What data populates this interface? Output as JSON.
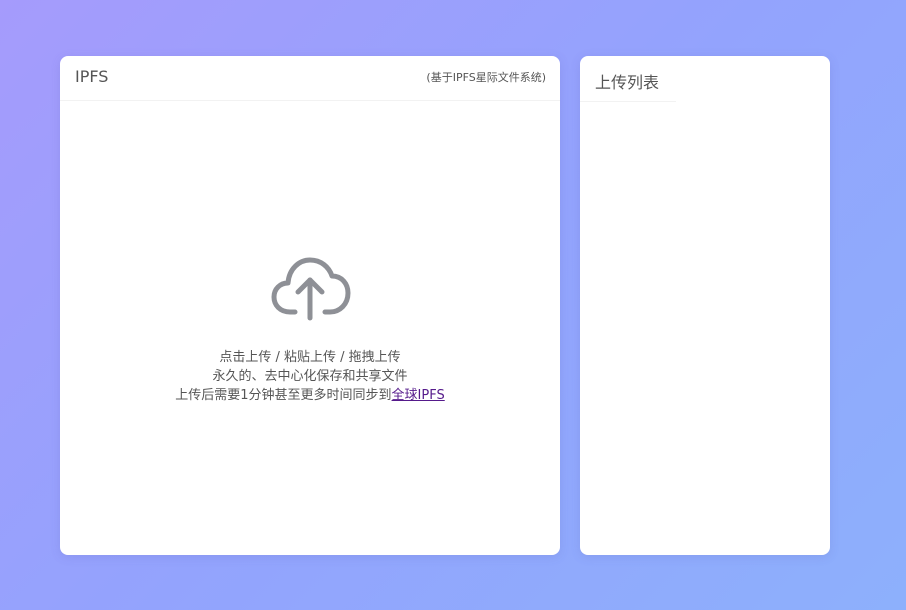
{
  "upload_panel": {
    "title": "IPFS",
    "subtitle": "(基于IPFS星际文件系统)",
    "hint_line1": "点击上传 / 粘贴上传 / 拖拽上传",
    "hint_line2": "永久的、去中心化保存和共享文件",
    "hint_line3_prefix": "上传后需要1分钟甚至更多时间同步到",
    "hint_line3_link": "全球IPFS",
    "icon": "cloud-upload-icon"
  },
  "list_panel": {
    "title": "上传列表",
    "items": []
  },
  "colors": {
    "background_gradient_start": "#a59bfc",
    "background_gradient_end": "#8db0fc",
    "card_background": "#ffffff",
    "icon_color": "#8e9096",
    "link_color": "#551a8b"
  }
}
